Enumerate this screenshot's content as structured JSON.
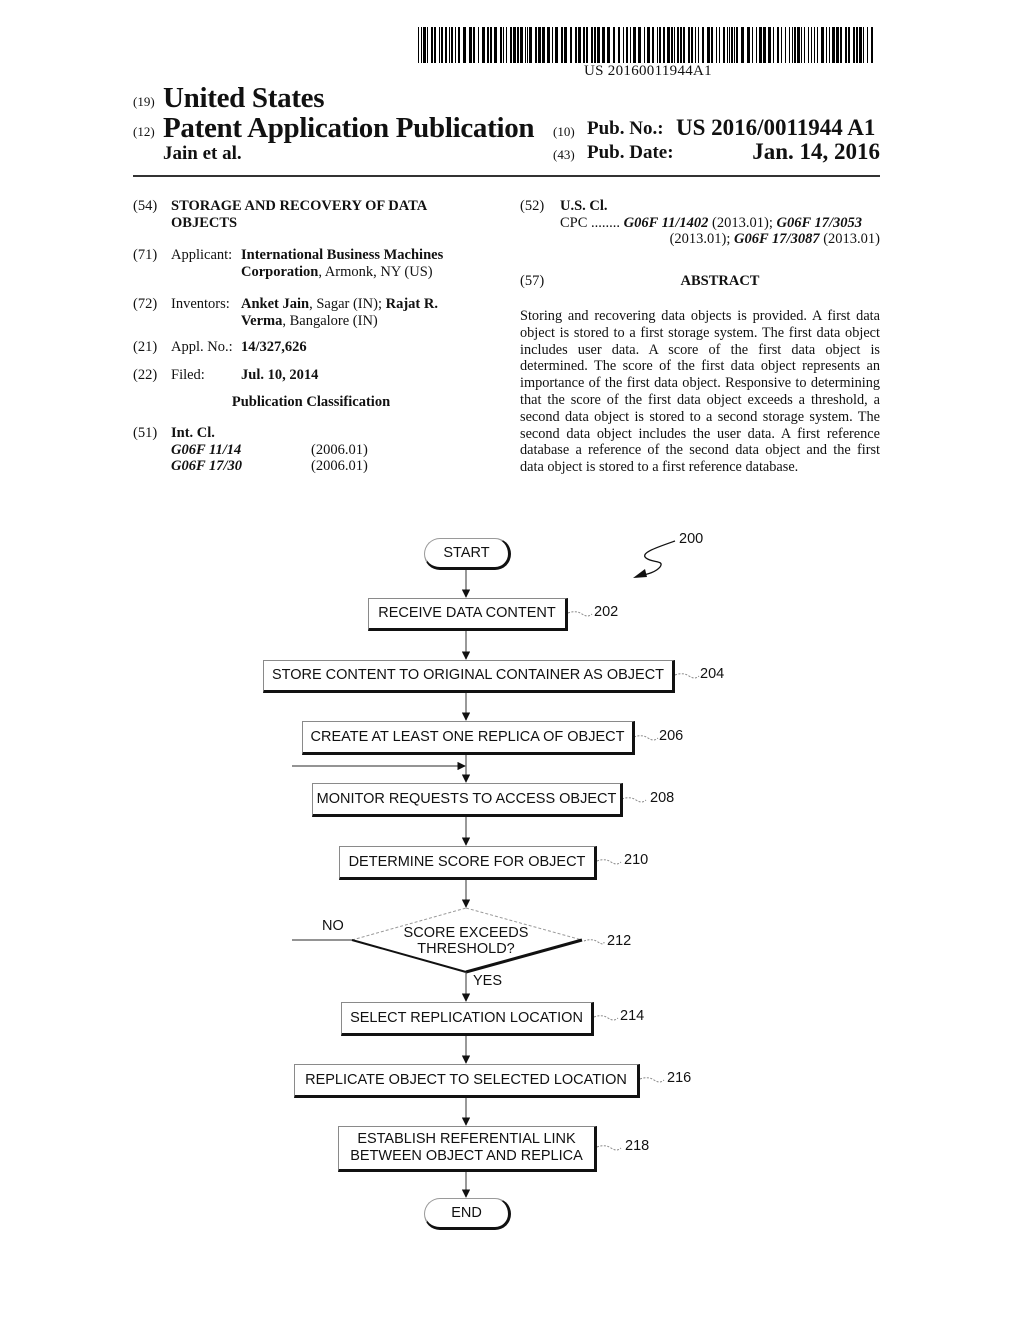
{
  "barcode": {
    "text": "US 20160011944A1"
  },
  "header": {
    "country_code": "(19)",
    "country": "United States",
    "type_code": "(12)",
    "type": "Patent Application Publication",
    "authors": "Jain et al.",
    "pub_no_code": "(10)",
    "pub_no_label": "Pub. No.:",
    "pub_no": "US 2016/0011944 A1",
    "pub_date_code": "(43)",
    "pub_date_label": "Pub. Date:",
    "pub_date": "Jan. 14, 2016"
  },
  "left_column": {
    "title": {
      "code": "(54)",
      "text_line1": "STORAGE AND RECOVERY OF DATA",
      "text_line2": "OBJECTS"
    },
    "applicant": {
      "code": "(71)",
      "label": "Applicant:",
      "name_bold": "International Business Machines",
      "name_bold2": "Corporation",
      "location": ", Armonk, NY (US)"
    },
    "inventors": {
      "code": "(72)",
      "label": "Inventors:",
      "inv1_name": "Anket Jain",
      "inv1_loc": ", Sagar (IN); ",
      "inv2_name_part1": "Rajat R.",
      "inv2_name_part2": "Verma",
      "inv2_loc": ", Bangalore (IN)"
    },
    "appl_no": {
      "code": "(21)",
      "label": "Appl. No.:",
      "value": "14/327,626"
    },
    "filed": {
      "code": "(22)",
      "label": "Filed:",
      "value": "Jul. 10, 2014"
    },
    "pub_class_heading": "Publication Classification",
    "int_cl": {
      "code": "(51)",
      "label": "Int. Cl.",
      "entries": [
        {
          "class": "G06F 11/14",
          "version": "(2006.01)"
        },
        {
          "class": "G06F 17/30",
          "version": "(2006.01)"
        }
      ]
    }
  },
  "right_column": {
    "us_cl": {
      "code": "(52)",
      "label": "U.S. Cl.",
      "cpc_prefix": "CPC ........",
      "cpc1": "G06F 11/1402",
      "cpc1_ver": " (2013.01); ",
      "cpc2": "G06F 17/3053",
      "cpc2_ver": "(2013.01); ",
      "cpc3": "G06F 17/3087",
      "cpc3_ver": " (2013.01)"
    },
    "abstract": {
      "code": "(57)",
      "heading": "ABSTRACT",
      "text": "Storing and recovering data objects is provided. A first data object is stored to a first storage system. The first data object includes user data. A score of the first data object is determined. The score of the first data object represents an importance of the first data object. Responsive to determining that the score of the first data object exceeds a threshold, a second data object is stored to a second storage system. The second data object includes the user data. A first reference database a reference of the second data object and the first data object is stored to a first reference database."
    }
  },
  "flowchart": {
    "figure_ref": "200",
    "start": "START",
    "end": "END",
    "steps": [
      {
        "id": "202",
        "label": "RECEIVE DATA CONTENT"
      },
      {
        "id": "204",
        "label": "STORE CONTENT TO ORIGINAL CONTAINER AS OBJECT"
      },
      {
        "id": "206",
        "label": "CREATE AT LEAST ONE REPLICA OF OBJECT"
      },
      {
        "id": "208",
        "label": "MONITOR REQUESTS TO ACCESS OBJECT"
      },
      {
        "id": "210",
        "label": "DETERMINE SCORE FOR OBJECT"
      },
      {
        "id": "212",
        "label_line1": "SCORE EXCEEDS",
        "label_line2": "THRESHOLD?"
      },
      {
        "id": "214",
        "label": "SELECT REPLICATION LOCATION"
      },
      {
        "id": "216",
        "label": "REPLICATE OBJECT TO SELECTED LOCATION"
      },
      {
        "id": "218",
        "label_line1": "ESTABLISH REFERENTIAL LINK",
        "label_line2": "BETWEEN OBJECT AND REPLICA"
      }
    ],
    "decision_no": "NO",
    "decision_yes": "YES"
  }
}
